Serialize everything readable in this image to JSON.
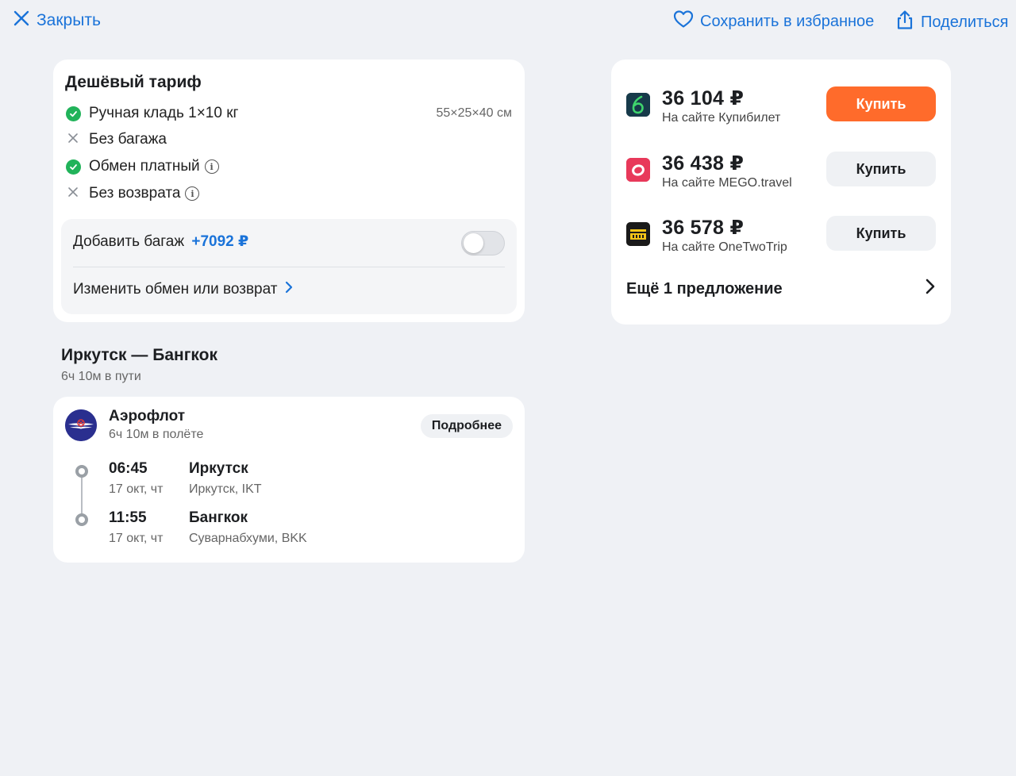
{
  "topbar": {
    "close_label": "Закрыть",
    "favorite_label": "Сохранить в избранное",
    "share_label": "Поделиться"
  },
  "tariff": {
    "title": "Дешёвый тариф",
    "features": [
      {
        "label": "Ручная кладь 1×10 кг",
        "status": "included",
        "info": false
      },
      {
        "label": "Без багажа",
        "status": "excluded",
        "info": false
      },
      {
        "label": "Обмен платный",
        "status": "included",
        "info": true
      },
      {
        "label": "Без возврата",
        "status": "excluded",
        "info": true
      }
    ],
    "carry_on_dimensions": "55×25×40 см",
    "add_baggage_label": "Добавить багаж",
    "add_baggage_price": "+7092 ₽",
    "add_baggage_enabled": false,
    "change_label": "Изменить обмен или возврат"
  },
  "route": {
    "title": "Иркутск — Бангкок",
    "duration": "6ч 10м в пути"
  },
  "flight": {
    "airline": "Аэрофлот",
    "flight_time": "6ч 10м в полёте",
    "details_label": "Подробнее",
    "departure": {
      "time": "06:45",
      "date": "17 окт, чт",
      "city": "Иркутск",
      "airport": "Иркутск, IKT"
    },
    "arrival": {
      "time": "11:55",
      "date": "17 окт, чт",
      "city": "Бангкок",
      "airport": "Суварнабхуми, BKK"
    }
  },
  "offers": {
    "items": [
      {
        "price": "36 104 ₽",
        "site": "На сайте Купибилет",
        "buy_label": "Купить",
        "primary": true
      },
      {
        "price": "36 438 ₽",
        "site": "На сайте MEGO.travel",
        "buy_label": "Купить",
        "primary": false
      },
      {
        "price": "36 578 ₽",
        "site": "На сайте OneTwoTrip",
        "buy_label": "Купить",
        "primary": false
      }
    ],
    "more_label": "Ещё 1 предложение"
  },
  "colors": {
    "background": "#eff1f5",
    "accent_blue": "#1a73d9",
    "buy_orange": "#ff6b2b",
    "check_green": "#21b35a"
  }
}
